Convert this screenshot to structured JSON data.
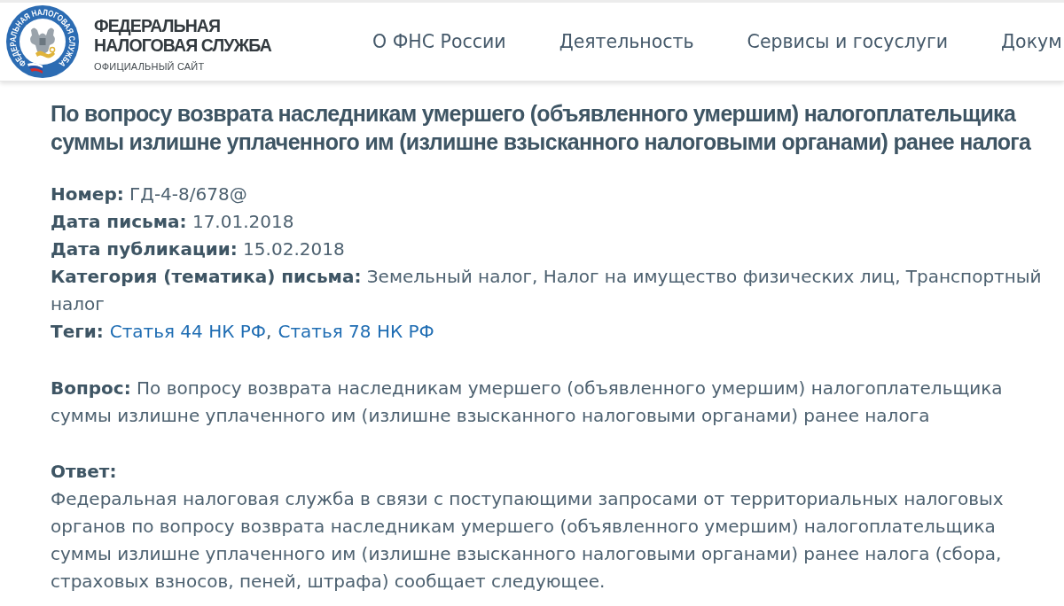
{
  "header": {
    "logo": {
      "ring_text": "ФЕДЕРАЛЬНАЯ НАЛОГОВАЯ СЛУЖБА"
    },
    "brand": {
      "title_lines": [
        "ФЕДЕРАЛЬНАЯ",
        "НАЛОГОВАЯ СЛУЖБА"
      ],
      "subtitle": "ОФИЦИАЛЬНЫЙ САЙТ"
    },
    "nav": [
      {
        "label": "О ФНС России"
      },
      {
        "label": "Деятельность"
      },
      {
        "label": "Сервисы и госуслуги"
      },
      {
        "label": "Докум"
      }
    ]
  },
  "article": {
    "title": "По вопросу возврата наследникам умершего (объявленного умершим) налогоплательщика суммы излишне уплаченного им (излишне взысканного налоговыми органами) ранее налога",
    "meta": [
      {
        "label": "Номер:",
        "value": "ГД-4-8/678@"
      },
      {
        "label": "Дата письма:",
        "value": "17.01.2018"
      },
      {
        "label": "Дата публикации:",
        "value": "15.02.2018"
      },
      {
        "label": "Категория (тематика) письма:",
        "value": "Земельный налог, Налог на имущество физических лиц, Транспортный налог"
      }
    ],
    "tags": {
      "label": "Теги:",
      "separator": ",",
      "items": [
        "Статья 44 НК РФ",
        "Статья 78 НК РФ"
      ]
    },
    "question": {
      "label": "Вопрос:",
      "text": "По вопросу возврата наследникам умершего (объявленного умершим) налогоплательщика суммы излишне уплаченного им (излишне взысканного налоговыми органами) ранее налога"
    },
    "answer": {
      "label": "Ответ:",
      "text": "Федеральная налоговая служба в связи с поступающими запросами от территориальных налоговых органов по вопросу возврата наследникам умершего (объявленного умершим) налогоплательщика суммы излишне уплаченного им (излишне взысканного налоговыми органами) ранее налога (сбора, страховых взносов, пеней, штрафа) сообщает следующее."
    }
  }
}
